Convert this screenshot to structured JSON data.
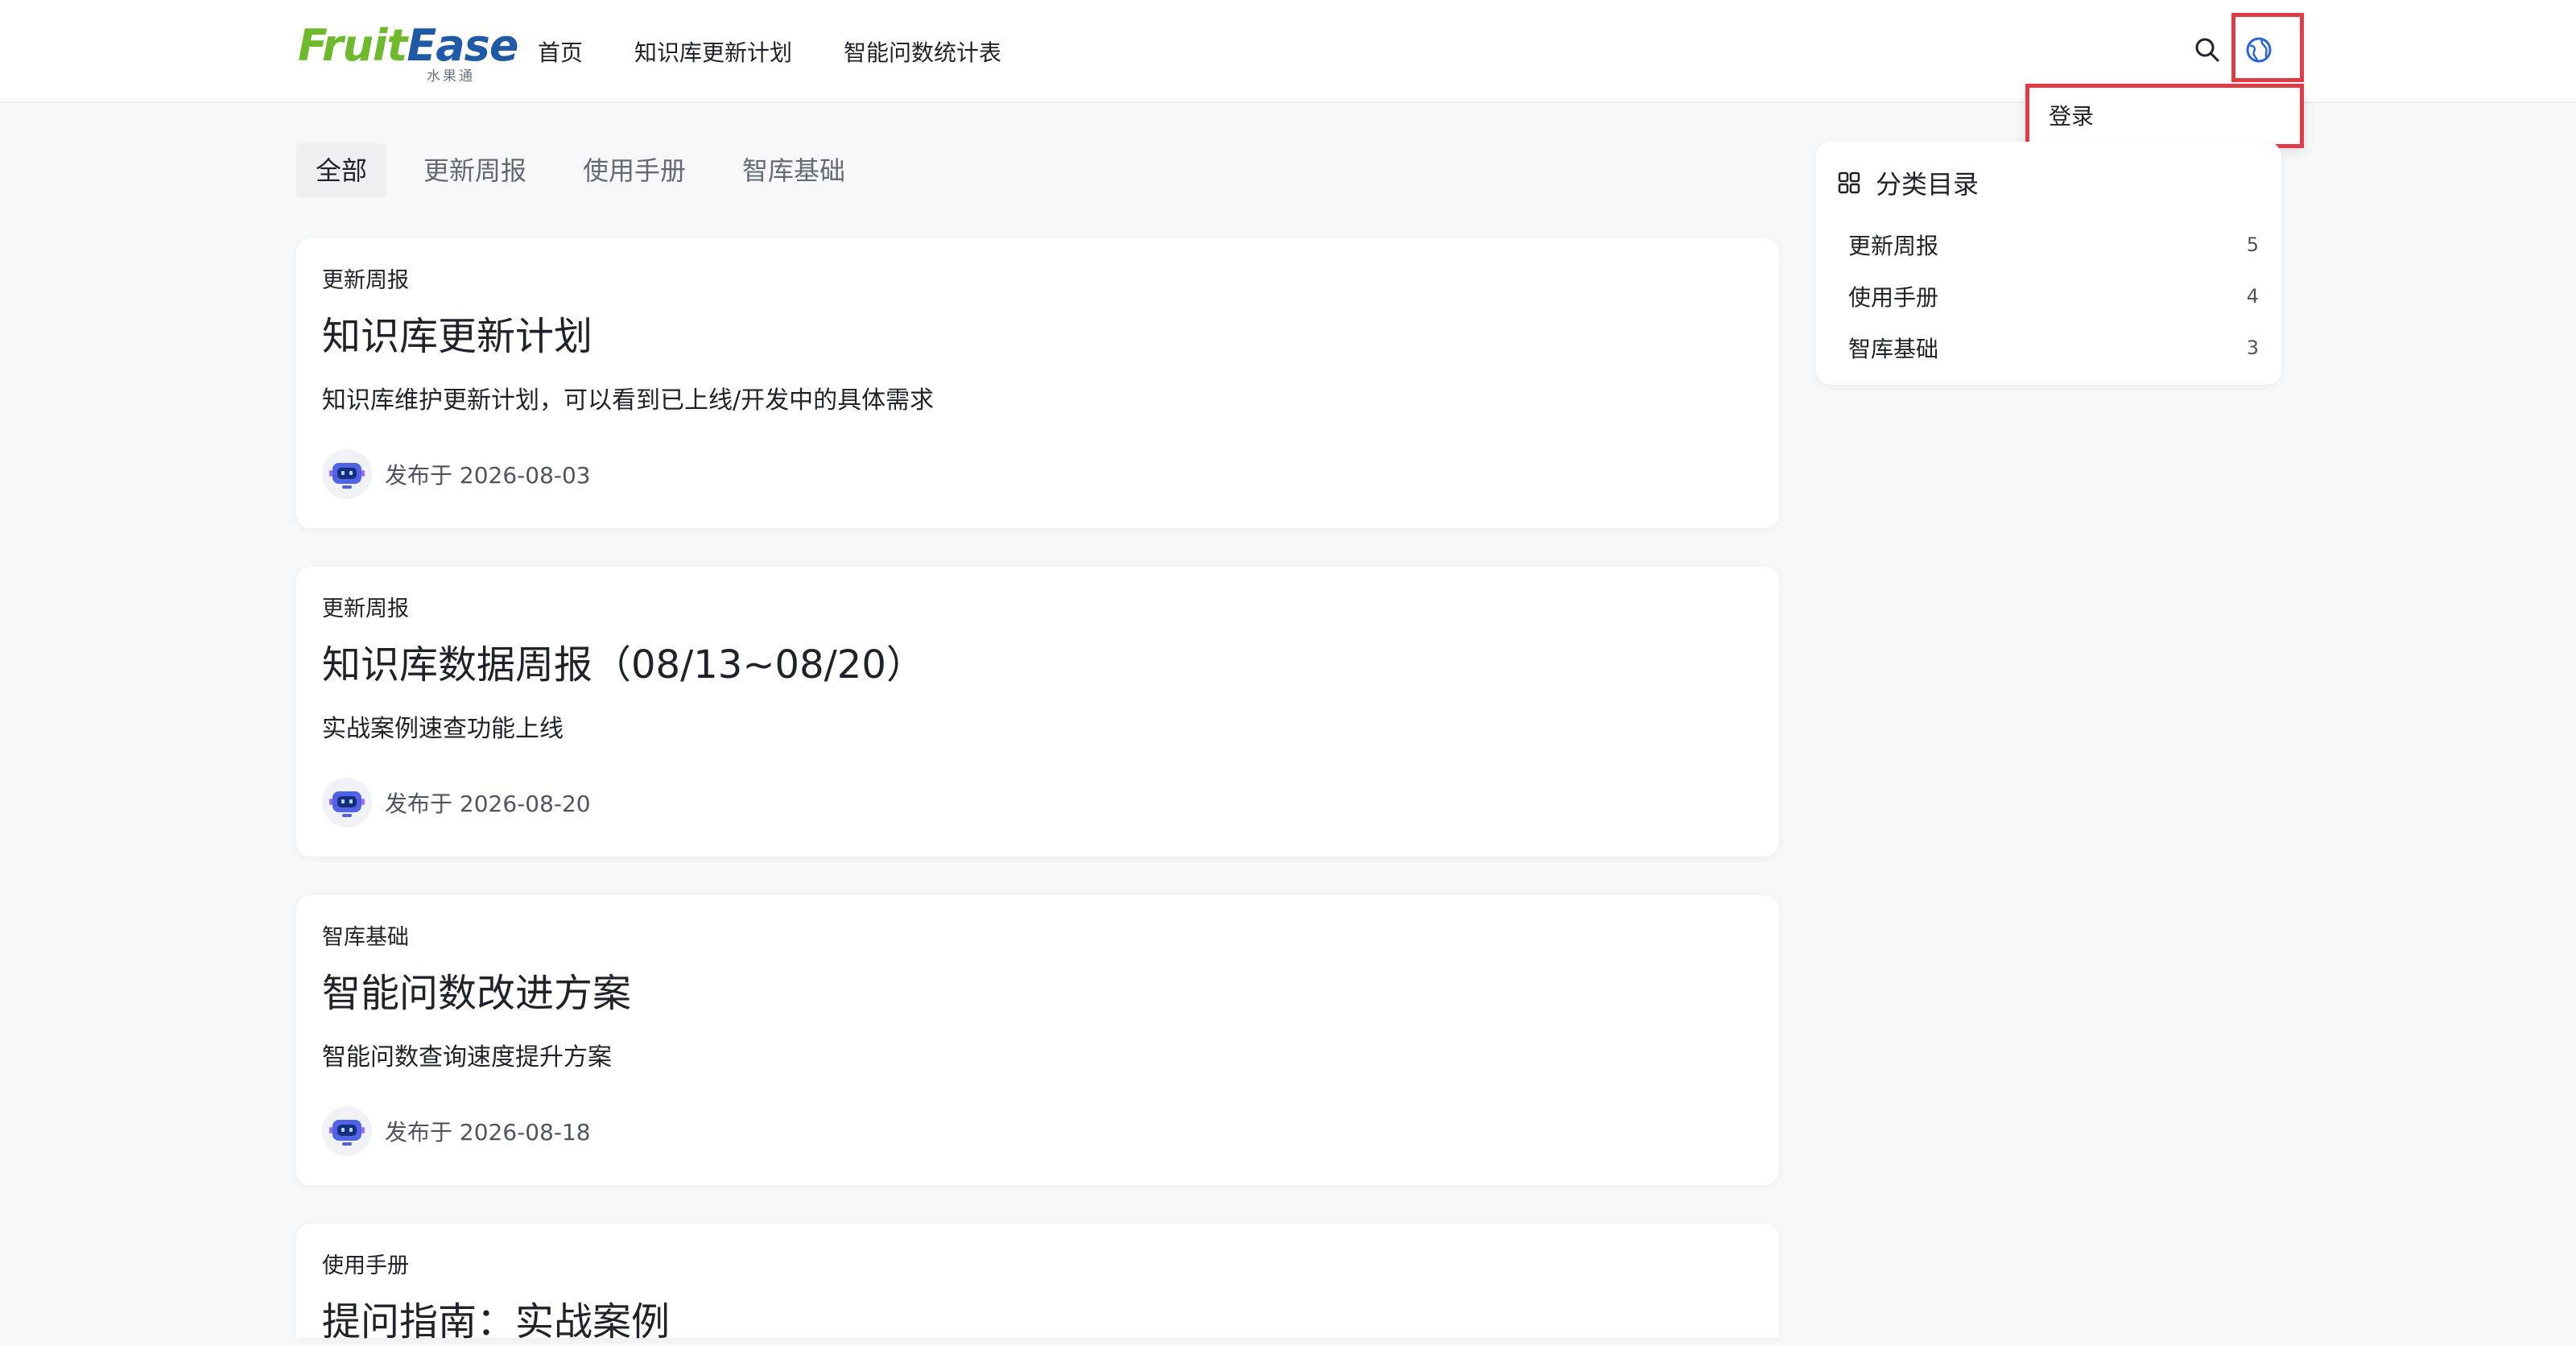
{
  "logo": {
    "brand_part1": "Fruit",
    "brand_part2": "Ease",
    "sub": "水果通"
  },
  "nav": {
    "items": [
      {
        "label": "首页"
      },
      {
        "label": "知识库更新计划"
      },
      {
        "label": "智能问数统计表"
      }
    ]
  },
  "header_icons": {
    "search": "search-icon",
    "globe": "globe-icon"
  },
  "dropdown": {
    "login_label": "登录"
  },
  "highlight_color": "#e03c46",
  "tabs": [
    {
      "label": "全部",
      "active": true
    },
    {
      "label": "更新周报",
      "active": false
    },
    {
      "label": "使用手册",
      "active": false
    },
    {
      "label": "智库基础",
      "active": false
    }
  ],
  "posts": [
    {
      "category": "更新周报",
      "title": "知识库更新计划",
      "desc": "知识库维护更新计划，可以看到已上线/开发中的具体需求",
      "meta": "发布于 2026-08-03"
    },
    {
      "category": "更新周报",
      "title": "知识库数据周报（08/13~08/20）",
      "desc": "实战案例速查功能上线",
      "meta": "发布于 2026-08-20"
    },
    {
      "category": "智库基础",
      "title": "智能问数改进方案",
      "desc": "智能问数查询速度提升方案",
      "meta": "发布于 2026-08-18"
    },
    {
      "category": "使用手册",
      "title": "提问指南：实战案例",
      "desc": "",
      "meta": ""
    }
  ],
  "sidebar": {
    "title": "分类目录",
    "items": [
      {
        "label": "更新周报",
        "count": "5"
      },
      {
        "label": "使用手册",
        "count": "4"
      },
      {
        "label": "智库基础",
        "count": "3"
      }
    ]
  }
}
